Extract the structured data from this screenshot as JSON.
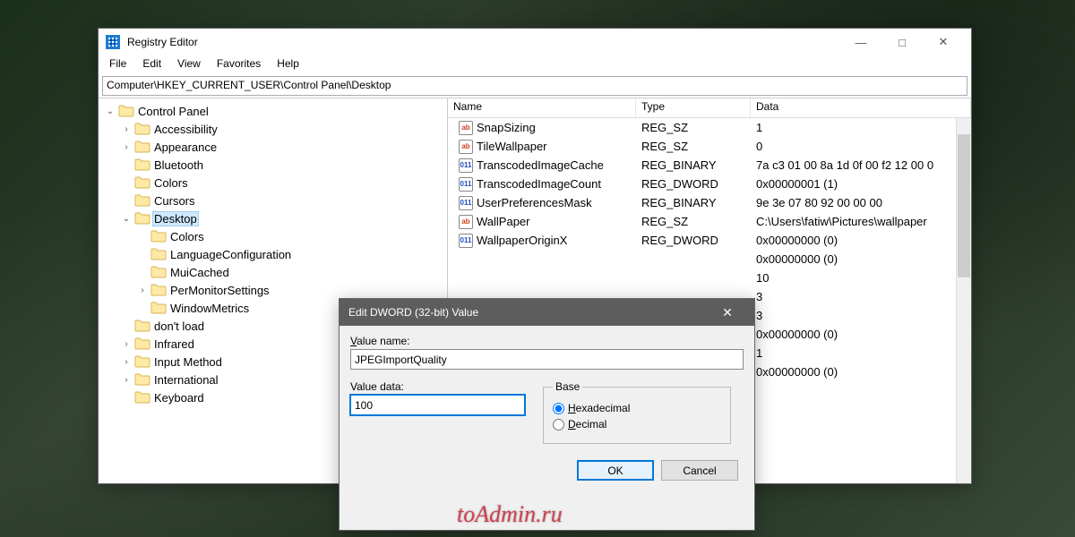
{
  "app": {
    "title": "Registry Editor",
    "watermark": "toAdmin.ru"
  },
  "menubar": [
    "File",
    "Edit",
    "View",
    "Favorites",
    "Help"
  ],
  "address": "Computer\\HKEY_CURRENT_USER\\Control Panel\\Desktop",
  "tree": [
    {
      "label": "Control Panel",
      "indent": 0,
      "expander": "v",
      "selected": false
    },
    {
      "label": "Accessibility",
      "indent": 1,
      "expander": ">",
      "selected": false
    },
    {
      "label": "Appearance",
      "indent": 1,
      "expander": ">",
      "selected": false
    },
    {
      "label": "Bluetooth",
      "indent": 1,
      "expander": "",
      "selected": false
    },
    {
      "label": "Colors",
      "indent": 1,
      "expander": "",
      "selected": false
    },
    {
      "label": "Cursors",
      "indent": 1,
      "expander": "",
      "selected": false
    },
    {
      "label": "Desktop",
      "indent": 1,
      "expander": "v",
      "selected": true
    },
    {
      "label": "Colors",
      "indent": 2,
      "expander": "",
      "selected": false
    },
    {
      "label": "LanguageConfiguration",
      "indent": 2,
      "expander": "",
      "selected": false
    },
    {
      "label": "MuiCached",
      "indent": 2,
      "expander": "",
      "selected": false
    },
    {
      "label": "PerMonitorSettings",
      "indent": 2,
      "expander": ">",
      "selected": false
    },
    {
      "label": "WindowMetrics",
      "indent": 2,
      "expander": "",
      "selected": false
    },
    {
      "label": "don't load",
      "indent": 1,
      "expander": "",
      "selected": false
    },
    {
      "label": "Infrared",
      "indent": 1,
      "expander": ">",
      "selected": false
    },
    {
      "label": "Input Method",
      "indent": 1,
      "expander": ">",
      "selected": false
    },
    {
      "label": "International",
      "indent": 1,
      "expander": ">",
      "selected": false
    },
    {
      "label": "Keyboard",
      "indent": 1,
      "expander": "",
      "selected": false
    }
  ],
  "list": {
    "headers": {
      "name": "Name",
      "type": "Type",
      "data": "Data"
    },
    "rows": [
      {
        "icon": "str",
        "name": "SnapSizing",
        "type": "REG_SZ",
        "data": "1"
      },
      {
        "icon": "str",
        "name": "TileWallpaper",
        "type": "REG_SZ",
        "data": "0"
      },
      {
        "icon": "bin",
        "name": "TranscodedImageCache",
        "type": "REG_BINARY",
        "data": "7a c3 01 00 8a 1d 0f 00 f2 12 00 0"
      },
      {
        "icon": "bin",
        "name": "TranscodedImageCount",
        "type": "REG_DWORD",
        "data": "0x00000001 (1)"
      },
      {
        "icon": "bin",
        "name": "UserPreferencesMask",
        "type": "REG_BINARY",
        "data": "9e 3e 07 80 92 00 00 00"
      },
      {
        "icon": "str",
        "name": "WallPaper",
        "type": "REG_SZ",
        "data": "C:\\Users\\fatiw\\Pictures\\wallpaper"
      },
      {
        "icon": "bin",
        "name": "WallpaperOriginX",
        "type": "REG_DWORD",
        "data": "0x00000000 (0)"
      },
      {
        "icon": "",
        "name": "",
        "type": "",
        "data": "0x00000000 (0)"
      },
      {
        "icon": "",
        "name": "",
        "type": "",
        "data": "10"
      },
      {
        "icon": "",
        "name": "",
        "type": "",
        "data": "3"
      },
      {
        "icon": "",
        "name": "",
        "type": "",
        "data": "3"
      },
      {
        "icon": "",
        "name": "",
        "type": "",
        "data": "0x00000000 (0)"
      },
      {
        "icon": "",
        "name": "",
        "type": "",
        "data": "1"
      },
      {
        "icon": "",
        "name": "",
        "type": "",
        "data": "0x00000000 (0)"
      }
    ]
  },
  "dialog": {
    "title": "Edit DWORD (32-bit) Value",
    "value_name_label": "Value name:",
    "value_name": "JPEGImportQuality",
    "value_data_label": "Value data:",
    "value_data": "100",
    "base_label": "Base",
    "hex_label": "Hexadecimal",
    "dec_label": "Decimal",
    "ok": "OK",
    "cancel": "Cancel"
  }
}
